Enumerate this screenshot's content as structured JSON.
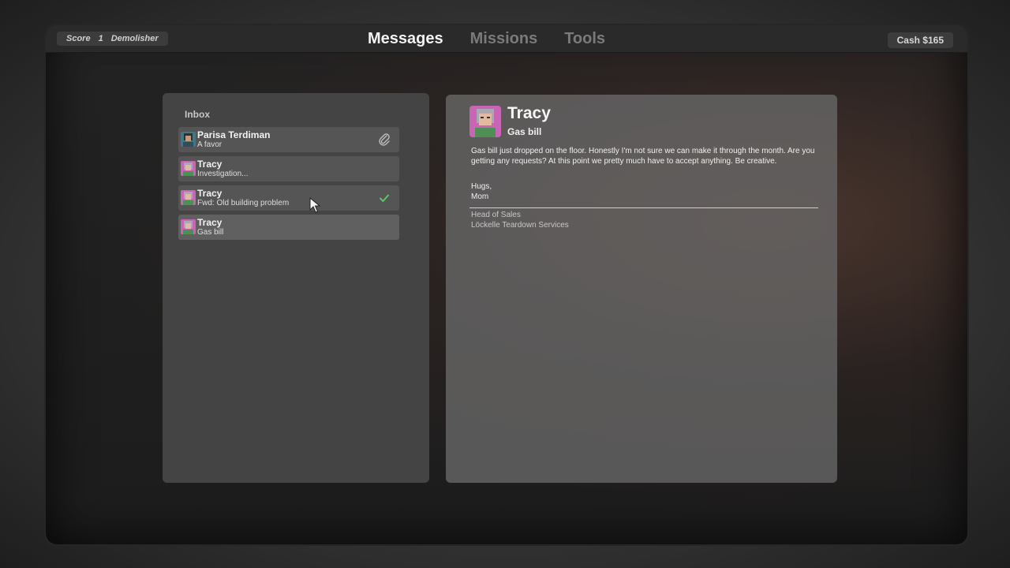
{
  "topbar": {
    "score_label": "Score",
    "score_value": "1",
    "rank": "Demolisher",
    "tabs": [
      "Messages",
      "Missions",
      "Tools"
    ],
    "active_tab": "Messages",
    "cash": "Cash $165"
  },
  "inbox": {
    "title": "Inbox",
    "messages": [
      {
        "from": "Parisa Terdiman",
        "subject": "A favor",
        "icon": "paperclip-icon"
      },
      {
        "from": "Tracy",
        "subject": "Investigation..."
      },
      {
        "from": "Tracy",
        "subject": "Fwd: Old building problem",
        "icon": "checkmark-icon"
      },
      {
        "from": "Tracy",
        "subject": "Gas bill",
        "selected": true
      }
    ]
  },
  "reader": {
    "from": "Tracy",
    "subject": "Gas bill",
    "body": "Gas bill just dropped on the floor. Honestly I'm not sure we can make it through the month. Are you getting any requests? At this point we pretty much have to accept anything. Be creative.",
    "closing": "Hugs,",
    "signoff": "Mom",
    "sig_title": "Head of Sales",
    "sig_company": "Löckelle Teardown Services"
  },
  "colors": {
    "accent_check": "#5fc26a",
    "tab_active": "#f2f2f2",
    "tab_inactive": "#7a7a7a"
  }
}
